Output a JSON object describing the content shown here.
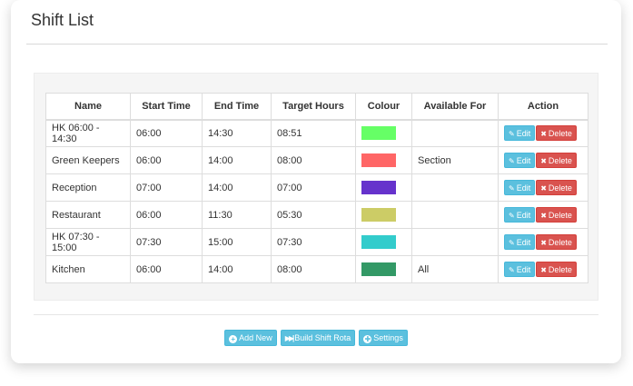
{
  "page": {
    "title": "Shift List"
  },
  "table": {
    "headers": [
      "Name",
      "Start Time",
      "End Time",
      "Target Hours",
      "Colour",
      "Available For",
      "Action"
    ],
    "rows": [
      {
        "name": "HK 06:00 - 14:30",
        "start": "06:00",
        "end": "14:30",
        "target": "08:51",
        "colour": "#66ff66",
        "available": ""
      },
      {
        "name": "Green Keepers",
        "start": "06:00",
        "end": "14:00",
        "target": "08:00",
        "colour": "#ff6666",
        "available": "Section"
      },
      {
        "name": "Reception",
        "start": "07:00",
        "end": "14:00",
        "target": "07:00",
        "colour": "#6633cc",
        "available": ""
      },
      {
        "name": "Restaurant",
        "start": "06:00",
        "end": "11:30",
        "target": "05:30",
        "colour": "#cccc66",
        "available": ""
      },
      {
        "name": "HK 07:30 - 15:00",
        "start": "07:30",
        "end": "15:00",
        "target": "07:30",
        "colour": "#33cccc",
        "available": ""
      },
      {
        "name": "Kitchen",
        "start": "06:00",
        "end": "14:00",
        "target": "08:00",
        "colour": "#339966",
        "available": "All"
      }
    ],
    "edit_label": "Edit",
    "delete_label": "Delete",
    "edit_icon": "pencil-icon",
    "delete_icon": "close-icon"
  },
  "footer": {
    "add_new_label": "Add New",
    "build_rota_label": "Build Shift Rota",
    "settings_label": "Settings",
    "add_new_icon": "plus-circle-icon",
    "build_rota_icon": "fast-forward-icon",
    "settings_icon": "gear-circle-icon"
  },
  "colors": {
    "info": "#5bc0de",
    "danger": "#d9534f"
  }
}
